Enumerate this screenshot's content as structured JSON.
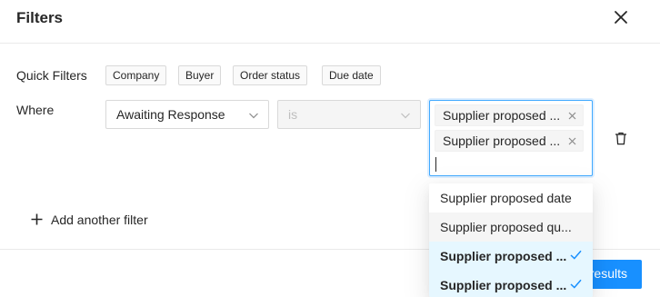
{
  "header": {
    "title": "Filters"
  },
  "quick_filters": {
    "label": "Quick Filters",
    "chips": [
      "Company",
      "Buyer",
      "Order status",
      "Due date"
    ]
  },
  "where": {
    "label": "Where",
    "field_select": "Awaiting Response",
    "operator_select": "is",
    "value_tags": [
      "Supplier proposed ...",
      "Supplier proposed ..."
    ],
    "search_value": ""
  },
  "dropdown": {
    "options": [
      {
        "label": "Supplier proposed date",
        "state": "normal"
      },
      {
        "label": "Supplier proposed qu...",
        "state": "active"
      },
      {
        "label": "Supplier proposed ...",
        "state": "selected"
      },
      {
        "label": "Supplier proposed ...",
        "state": "selected"
      }
    ]
  },
  "add_filter": {
    "label": "Add another filter"
  },
  "footer": {
    "results_button": "Show results"
  },
  "colors": {
    "primary": "#1890ff",
    "selected_bg": "#e6f7ff",
    "check": "#1890ff",
    "border": "#d9d9d9"
  },
  "icons": {
    "close": "close-icon",
    "chevron": "chevron-down-icon",
    "tag_close": "tag-close-icon",
    "trash": "trash-icon",
    "plus": "plus-icon",
    "check": "check-icon"
  }
}
